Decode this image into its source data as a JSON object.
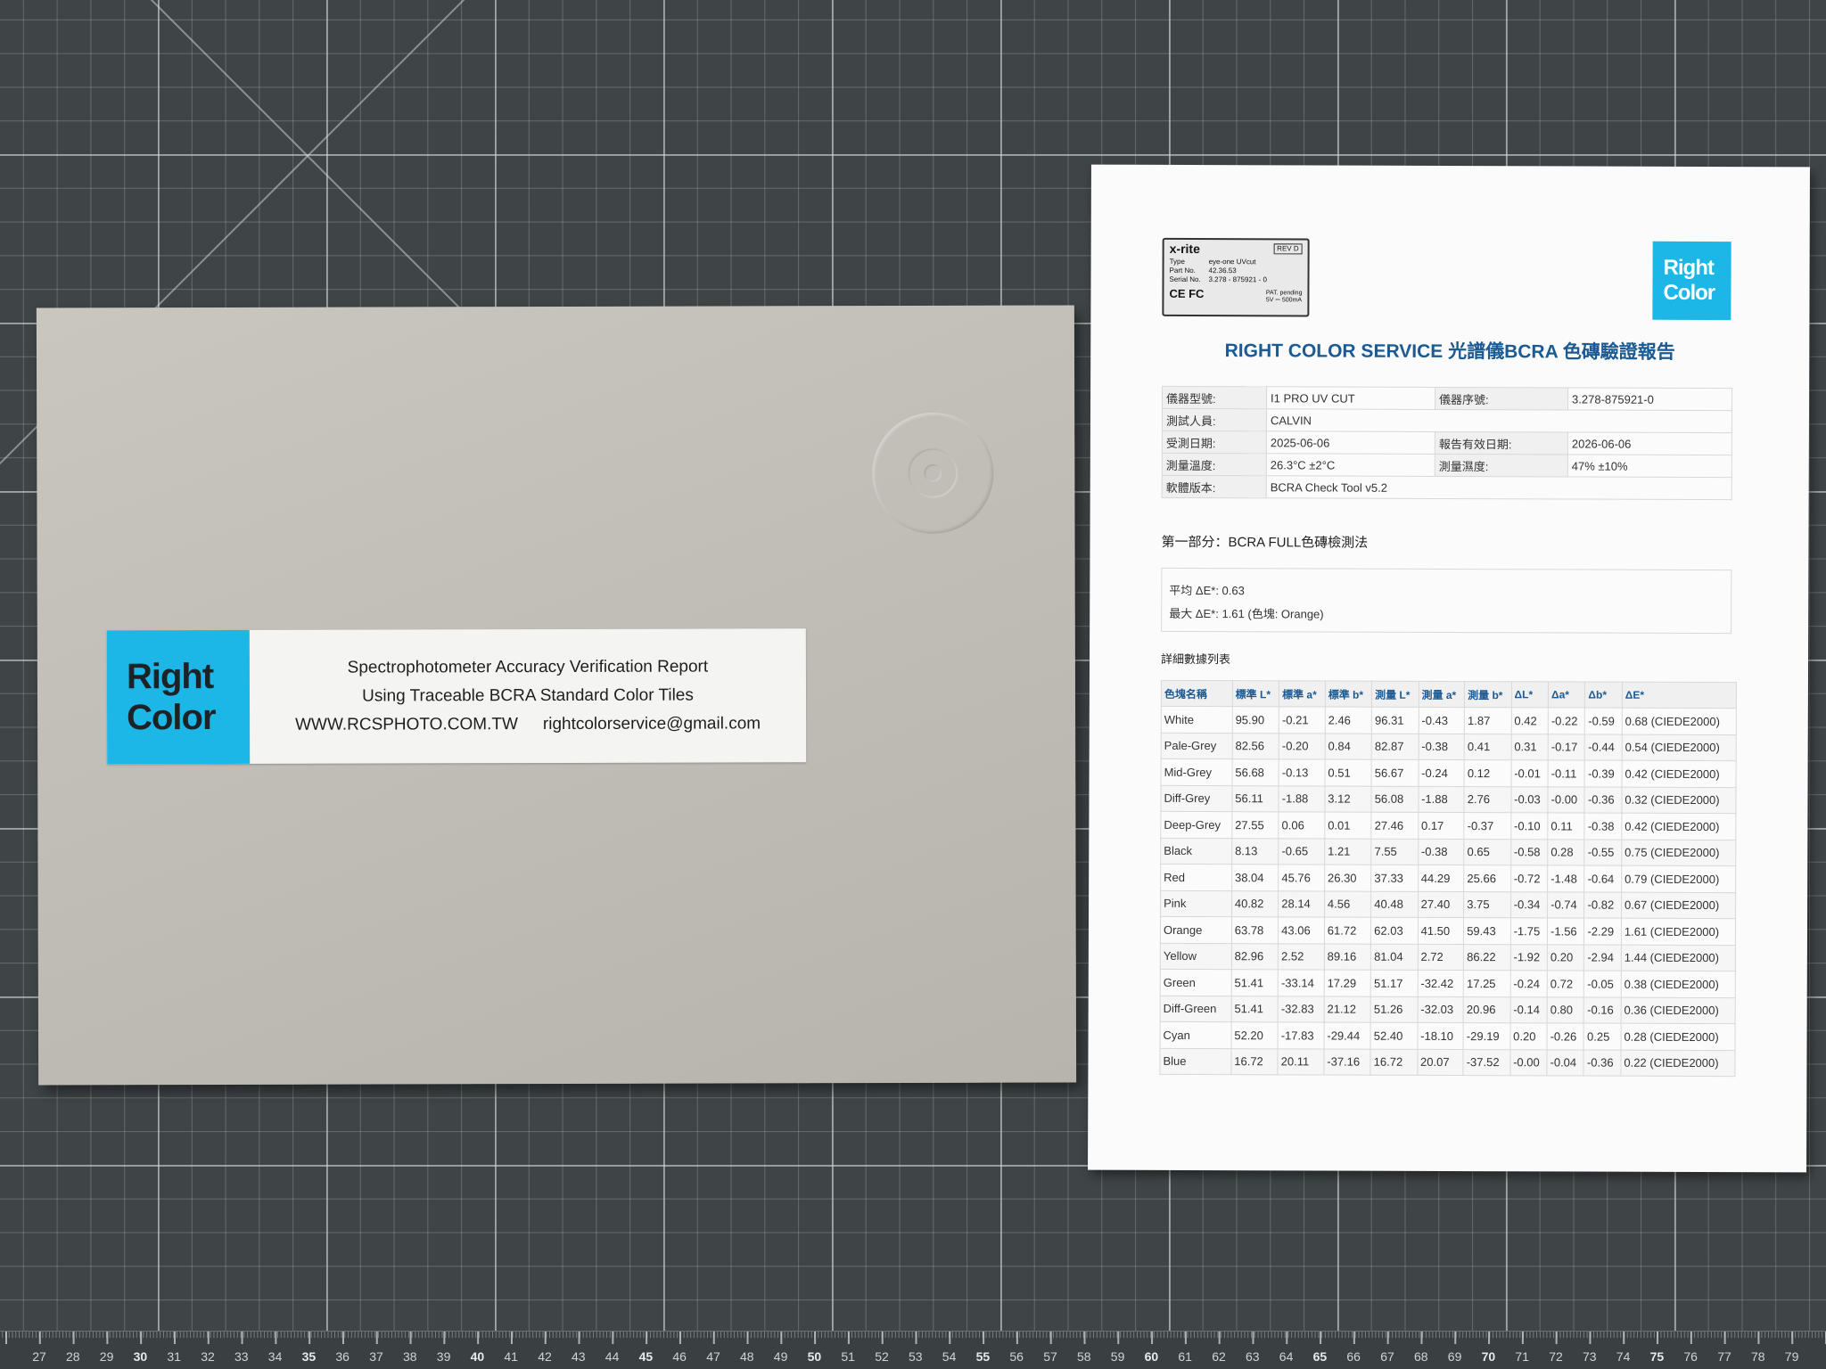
{
  "label": {
    "logo_line1": "Right",
    "logo_line2": "Color",
    "title_line1": "Spectrophotometer Accuracy Verification Report",
    "title_line2": "Using Traceable BCRA Standard Color Tiles",
    "website": "WWW.RCSPHOTO.COM.TW",
    "email": "rightcolorservice@gmail.com"
  },
  "device_label": {
    "brand": "x-rite",
    "rev": "REV D",
    "type_key": "Type",
    "type_val": "eye-one UVcut",
    "part_key": "Part No.",
    "part_val": "42.36.53",
    "serial_key": "Serial No.",
    "serial_val": "3.278 - 875921 - 0",
    "marks": "CE FC",
    "pat": "PAT. pending",
    "power": "5V ⎓ 500mA"
  },
  "report": {
    "logo_line1": "Right",
    "logo_line2": "Color",
    "title": "RIGHT COLOR SERVICE 光譜儀BCRA 色磚驗證報告",
    "info": {
      "model_label": "儀器型號:",
      "model": "I1 PRO UV CUT",
      "serial_label": "儀器序號:",
      "serial": "3.278-875921-0",
      "tester_label": "測試人員:",
      "tester": "CALVIN",
      "date_label": "受測日期:",
      "date": "2025-06-06",
      "valid_label": "報告有效日期:",
      "valid": "2026-06-06",
      "temp_label": "測量溫度:",
      "temp": "26.3°C ±2°C",
      "humid_label": "測量濕度:",
      "humid": "47% ±10%",
      "software_label": "軟體版本:",
      "software": "BCRA Check Tool v5.2"
    },
    "section1_title": "第一部分：BCRA FULL色磚檢測法",
    "avg_line": "平均 ΔE*: 0.63",
    "max_line": "最大 ΔE*: 1.61 (色塊: Orange)",
    "detail_title": "詳細數據列表",
    "columns": [
      "色塊名稱",
      "標準 L*",
      "標準 a*",
      "標準 b*",
      "測量 L*",
      "測量 a*",
      "測量 b*",
      "ΔL*",
      "Δa*",
      "Δb*",
      "ΔE*"
    ],
    "rows": [
      [
        "White",
        "95.90",
        "-0.21",
        "2.46",
        "96.31",
        "-0.43",
        "1.87",
        "0.42",
        "-0.22",
        "-0.59",
        "0.68 (CIEDE2000)"
      ],
      [
        "Pale-Grey",
        "82.56",
        "-0.20",
        "0.84",
        "82.87",
        "-0.38",
        "0.41",
        "0.31",
        "-0.17",
        "-0.44",
        "0.54 (CIEDE2000)"
      ],
      [
        "Mid-Grey",
        "56.68",
        "-0.13",
        "0.51",
        "56.67",
        "-0.24",
        "0.12",
        "-0.01",
        "-0.11",
        "-0.39",
        "0.42 (CIEDE2000)"
      ],
      [
        "Diff-Grey",
        "56.11",
        "-1.88",
        "3.12",
        "56.08",
        "-1.88",
        "2.76",
        "-0.03",
        "-0.00",
        "-0.36",
        "0.32 (CIEDE2000)"
      ],
      [
        "Deep-Grey",
        "27.55",
        "0.06",
        "0.01",
        "27.46",
        "0.17",
        "-0.37",
        "-0.10",
        "0.11",
        "-0.38",
        "0.42 (CIEDE2000)"
      ],
      [
        "Black",
        "8.13",
        "-0.65",
        "1.21",
        "7.55",
        "-0.38",
        "0.65",
        "-0.58",
        "0.28",
        "-0.55",
        "0.75 (CIEDE2000)"
      ],
      [
        "Red",
        "38.04",
        "45.76",
        "26.30",
        "37.33",
        "44.29",
        "25.66",
        "-0.72",
        "-1.48",
        "-0.64",
        "0.79 (CIEDE2000)"
      ],
      [
        "Pink",
        "40.82",
        "28.14",
        "4.56",
        "40.48",
        "27.40",
        "3.75",
        "-0.34",
        "-0.74",
        "-0.82",
        "0.67 (CIEDE2000)"
      ],
      [
        "Orange",
        "63.78",
        "43.06",
        "61.72",
        "62.03",
        "41.50",
        "59.43",
        "-1.75",
        "-1.56",
        "-2.29",
        "1.61 (CIEDE2000)"
      ],
      [
        "Yellow",
        "82.96",
        "2.52",
        "89.16",
        "81.04",
        "2.72",
        "86.22",
        "-1.92",
        "0.20",
        "-2.94",
        "1.44 (CIEDE2000)"
      ],
      [
        "Green",
        "51.41",
        "-33.14",
        "17.29",
        "51.17",
        "-32.42",
        "17.25",
        "-0.24",
        "0.72",
        "-0.05",
        "0.38 (CIEDE2000)"
      ],
      [
        "Diff-Green",
        "51.41",
        "-32.83",
        "21.12",
        "51.26",
        "-32.03",
        "20.96",
        "-0.14",
        "0.80",
        "-0.16",
        "0.36 (CIEDE2000)"
      ],
      [
        "Cyan",
        "52.20",
        "-17.83",
        "-29.44",
        "52.40",
        "-18.10",
        "-29.19",
        "0.20",
        "-0.26",
        "0.25",
        "0.28 (CIEDE2000)"
      ],
      [
        "Blue",
        "16.72",
        "20.11",
        "-37.16",
        "16.72",
        "20.07",
        "-37.52",
        "-0.00",
        "-0.04",
        "-0.36",
        "0.22 (CIEDE2000)"
      ]
    ]
  },
  "ruler": {
    "numbers": [
      "27",
      "28",
      "29",
      "30",
      "31",
      "32",
      "33",
      "34",
      "35",
      "36",
      "37",
      "38",
      "39",
      "40",
      "41",
      "42",
      "43",
      "44",
      "45",
      "46",
      "47",
      "48",
      "49",
      "50",
      "51",
      "52",
      "53",
      "54",
      "55",
      "56",
      "57",
      "58",
      "59",
      "60",
      "61",
      "62",
      "63",
      "64",
      "65",
      "66",
      "67",
      "68",
      "69",
      "70",
      "71",
      "72",
      "73",
      "74",
      "75",
      "76",
      "77",
      "78",
      "79"
    ]
  },
  "colors": {
    "mat": "#3f4547",
    "brand_cyan": "#1cb7e6",
    "folder": "#c4c1ba",
    "title_blue": "#1b5a92"
  }
}
